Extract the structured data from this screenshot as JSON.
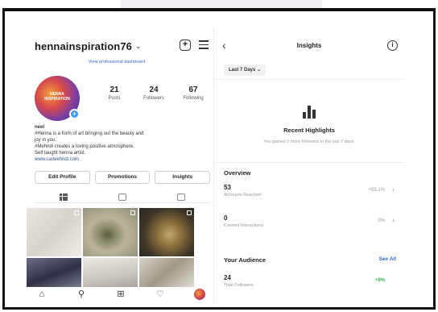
{
  "profile": {
    "username": "hennainspiration76",
    "dropdown_icon": "chevron-down-icon",
    "pro_dashboard_link": "View professional dashboard",
    "avatar_text": "HENNA INSPIRATION",
    "stats": [
      {
        "value": "21",
        "label": "Posts"
      },
      {
        "value": "24",
        "label": "Followers"
      },
      {
        "value": "67",
        "label": "Following"
      }
    ],
    "bio": {
      "name": "neel",
      "line1": "#Henna is a form of art bringing out the beauty and",
      "line2": "joy in you.",
      "line3": "#Mehndi creates a loving positive atmosphere.",
      "line4": "Self taught henna artist.",
      "link": "www.carleehndi.com"
    },
    "buttons": {
      "edit": "Edit Profile",
      "promotions": "Promotions",
      "insights": "Insights"
    }
  },
  "insights": {
    "title": "Insights",
    "range": "Last 7 Days",
    "highlights_title": "Recent Highlights",
    "highlights_sub": "You gained 2 more followers in the last 7 days.",
    "overview_title": "Overview",
    "accounts_reached": {
      "value": "53",
      "label": "Accounts Reached",
      "pct": "+93.1%"
    },
    "content_interactions": {
      "value": "0",
      "label": "Content Interactions",
      "pct": "0%"
    },
    "audience_title": "Your Audience",
    "see_all": "See All",
    "total_followers": {
      "value": "24",
      "label": "Total Followers",
      "pct": "+9%"
    }
  },
  "colors": {
    "link_blue": "#3b6cc8",
    "see_all_blue": "#2f6bd8",
    "positive_green": "#37b34a"
  }
}
